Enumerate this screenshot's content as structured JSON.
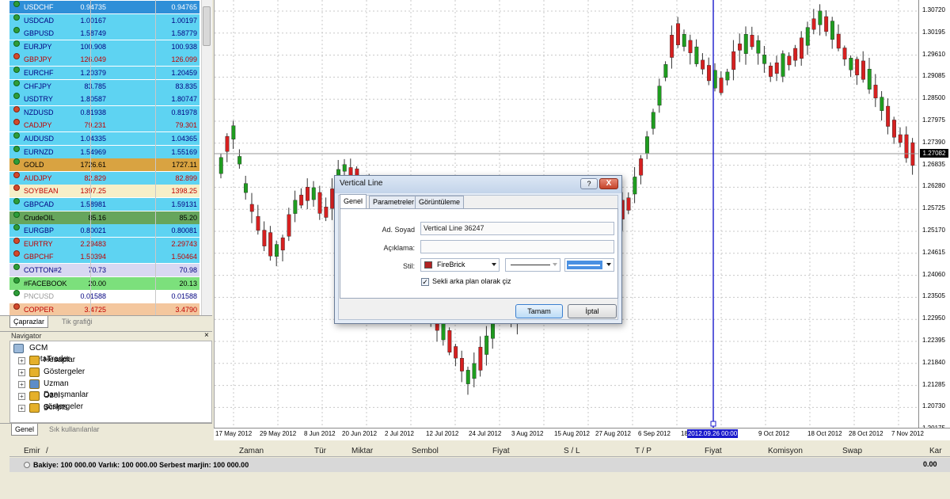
{
  "market_watch": {
    "rows": [
      {
        "symbol": "USDCHF",
        "bid": "0.94735",
        "ask": "0.94765",
        "bg": "#2f8fd8",
        "fg": "#ffffff",
        "dir": "up"
      },
      {
        "symbol": "USDCAD",
        "bid": "1.00167",
        "ask": "1.00197",
        "bg": "#5ed3f2",
        "fg": "#000080",
        "dir": "up"
      },
      {
        "symbol": "GBPUSD",
        "bid": "1.58749",
        "ask": "1.58779",
        "bg": "#5ed3f2",
        "fg": "#000080",
        "dir": "up"
      },
      {
        "symbol": "EURJPY",
        "bid": "100.908",
        "ask": "100.938",
        "bg": "#5ed3f2",
        "fg": "#000080",
        "dir": "up"
      },
      {
        "symbol": "GBPJPY",
        "bid": "126.049",
        "ask": "126.099",
        "bg": "#5ed3f2",
        "fg": "#c00000",
        "dir": "down"
      },
      {
        "symbol": "EURCHF",
        "bid": "1.20379",
        "ask": "1.20459",
        "bg": "#5ed3f2",
        "fg": "#000080",
        "dir": "up"
      },
      {
        "symbol": "CHFJPY",
        "bid": "83.785",
        "ask": "83.835",
        "bg": "#5ed3f2",
        "fg": "#000080",
        "dir": "up"
      },
      {
        "symbol": "USDTRY",
        "bid": "1.80587",
        "ask": "1.80747",
        "bg": "#5ed3f2",
        "fg": "#000080",
        "dir": "up"
      },
      {
        "symbol": "NZDUSD",
        "bid": "0.81938",
        "ask": "0.81978",
        "bg": "#5ed3f2",
        "fg": "#000080",
        "dir": "down"
      },
      {
        "symbol": "CADJPY",
        "bid": "79.231",
        "ask": "79.301",
        "bg": "#5ed3f2",
        "fg": "#c00000",
        "dir": "down"
      },
      {
        "symbol": "AUDUSD",
        "bid": "1.04335",
        "ask": "1.04365",
        "bg": "#5ed3f2",
        "fg": "#000080",
        "dir": "up"
      },
      {
        "symbol": "EURNZD",
        "bid": "1.54969",
        "ask": "1.55169",
        "bg": "#5ed3f2",
        "fg": "#000080",
        "dir": "up"
      },
      {
        "symbol": "GOLD",
        "bid": "1726.61",
        "ask": "1727.11",
        "bg": "#d9a341",
        "fg": "#000000",
        "dir": "up"
      },
      {
        "symbol": "AUDJPY",
        "bid": "82.829",
        "ask": "82.899",
        "bg": "#5ed3f2",
        "fg": "#c00000",
        "dir": "down"
      },
      {
        "symbol": "SOYBEAN",
        "bid": "1397.25",
        "ask": "1398.25",
        "bg": "#f6efc8",
        "fg": "#c00000",
        "dir": "down"
      },
      {
        "symbol": "GBPCAD",
        "bid": "1.58981",
        "ask": "1.59131",
        "bg": "#5ed3f2",
        "fg": "#000080",
        "dir": "up"
      },
      {
        "symbol": "CrudeOIL",
        "bid": "85.16",
        "ask": "85.20",
        "bg": "#66a55c",
        "fg": "#000000",
        "dir": "up"
      },
      {
        "symbol": "EURGBP",
        "bid": "0.80021",
        "ask": "0.80081",
        "bg": "#5ed3f2",
        "fg": "#000080",
        "dir": "up"
      },
      {
        "symbol": "EURTRY",
        "bid": "2.29483",
        "ask": "2.29743",
        "bg": "#5ed3f2",
        "fg": "#c00000",
        "dir": "down"
      },
      {
        "symbol": "GBPCHF",
        "bid": "1.50394",
        "ask": "1.50464",
        "bg": "#5ed3f2",
        "fg": "#c00000",
        "dir": "down"
      },
      {
        "symbol": "COTTON#2",
        "bid": "70.73",
        "ask": "70.98",
        "bg": "#d8d8f2",
        "fg": "#000080",
        "dir": "up"
      },
      {
        "symbol": "#FACEBOOK",
        "bid": "20.00",
        "ask": "20.13",
        "bg": "#7ce07c",
        "fg": "#000000",
        "dir": "up"
      },
      {
        "symbol": "PNCUSD",
        "bid": "0.01588",
        "ask": "0.01588",
        "bg": "#ffffff",
        "fg": "#000080",
        "dir": "up",
        "dim": true
      },
      {
        "symbol": "COPPER",
        "bid": "3.4725",
        "ask": "3.4790",
        "bg": "#f4c79e",
        "fg": "#c00000",
        "dir": "down"
      }
    ],
    "tabs": [
      "Çaprazlar",
      "Tik grafiği"
    ]
  },
  "navigator": {
    "title": "Navigator",
    "close": "×",
    "root": "GCM MetaTrader",
    "items": [
      {
        "label": "Hesaplar",
        "color": "#e5b02a"
      },
      {
        "label": "Göstergeler",
        "color": "#e5b02a"
      },
      {
        "label": "Uzman Danışmanlar",
        "color": "#5c8dc7"
      },
      {
        "label": "Özel göstergeler",
        "color": "#e5b02a"
      },
      {
        "label": "Scripts",
        "color": "#e5b02a"
      }
    ],
    "tabs": [
      "Genel",
      "Sık kullanılanlar"
    ]
  },
  "chart": {
    "price_labels": [
      "1.30720",
      "1.30195",
      "1.29610",
      "1.29085",
      "1.28500",
      "1.27975",
      "1.27390",
      "1.26835",
      "1.26280",
      "1.25725",
      "1.25170",
      "1.24615",
      "1.24060",
      "1.23505",
      "1.22950",
      "1.22395",
      "1.21840",
      "1.21285",
      "1.20730",
      "1.20175"
    ],
    "current_price": "1.27082",
    "time_labels": [
      "17 May 2012",
      "29 May 2012",
      "8 Jun 2012",
      "20 Jun 2012",
      "2 Jul 2012",
      "12 Jul 2012",
      "24 Jul 2012",
      "3 Aug 2012",
      "15 Aug 2012",
      "27 Aug 2012",
      "6 Sep 2012",
      "18",
      "2012.09.26 00:00",
      "9 Oct 2012",
      "18 Oct 2012",
      "28 Oct 2012",
      "7 Nov 2012"
    ],
    "vertical_line_time": "2012.09.26 00:00",
    "bull_color": "#1f9d1f",
    "bear_color": "#d62020",
    "vline_color": "#1a1acc"
  },
  "dialog": {
    "title": "Vertical Line",
    "help": "?",
    "close": "X",
    "tabs": [
      "Genel",
      "Parametreler",
      "Görüntüleme"
    ],
    "name_label": "Ad. Soyad",
    "name_value": "Vertical Line 36247",
    "desc_label": "Açıklama:",
    "desc_value": "",
    "style_label": "Stil:",
    "color_name": "FireBrick",
    "color_hex": "#b22222",
    "background_label": "Sekli arka plan olarak çiz",
    "ok": "Tamam",
    "cancel": "İptal"
  },
  "terminal": {
    "columns": [
      "Emir",
      "/",
      "Zaman",
      "Tür",
      "Miktar",
      "Sembol",
      "Fiyat",
      "S / L",
      "T / P",
      "Fiyat",
      "Komisyon",
      "Swap",
      "Kar"
    ],
    "balance_line": "Bakiye: 100 000.00  Varlık: 100 000.00  Serbest marjin: 100 000.00",
    "balance_value": "0.00"
  }
}
